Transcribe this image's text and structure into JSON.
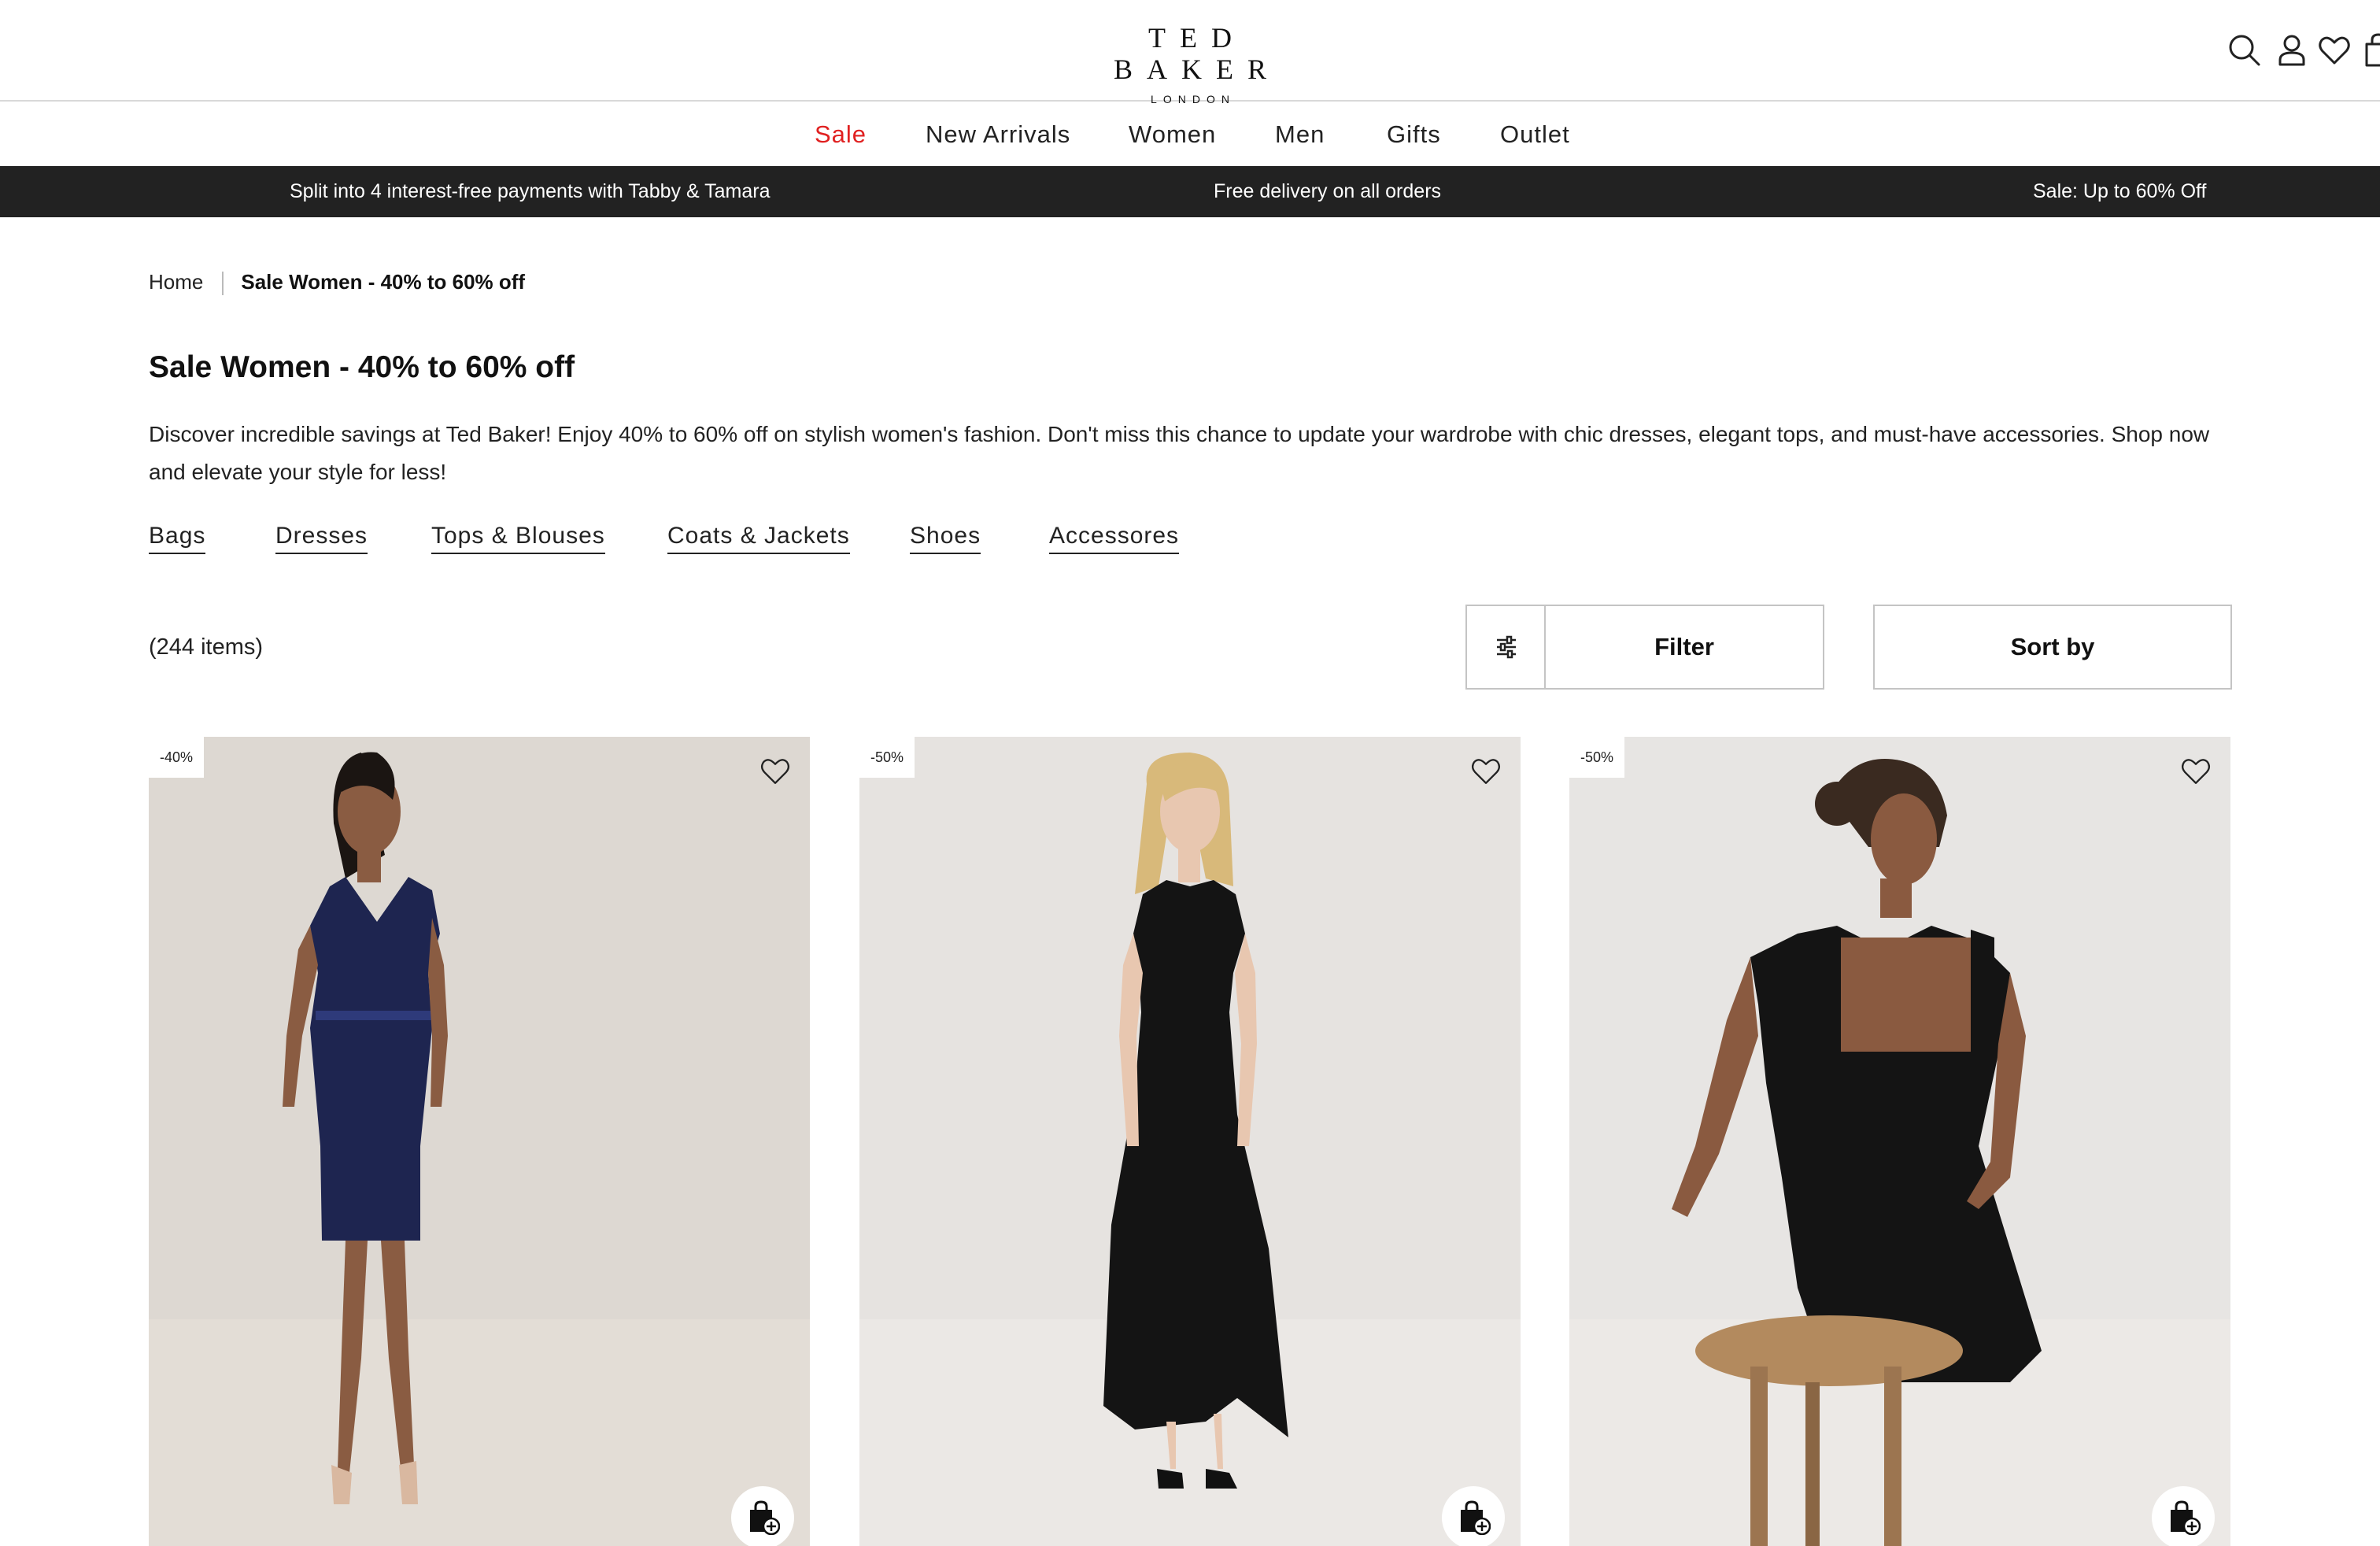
{
  "brand": {
    "name": "TED BAKER",
    "sub": "LONDON"
  },
  "header_icons": [
    "search-icon",
    "account-icon",
    "wishlist-icon",
    "bag-icon"
  ],
  "nav": [
    {
      "label": "Sale",
      "highlight": true
    },
    {
      "label": "New Arrivals"
    },
    {
      "label": "Women"
    },
    {
      "label": "Men"
    },
    {
      "label": "Gifts"
    },
    {
      "label": "Outlet"
    }
  ],
  "promo": [
    "Split into 4 interest-free payments with Tabby & Tamara",
    "Free delivery on all orders",
    "Sale: Up to 60% Off"
  ],
  "breadcrumb": {
    "home": "Home",
    "current": "Sale Women - 40% to 60% off"
  },
  "page_title": "Sale Women - 40% to 60% off",
  "description": "Discover incredible savings at Ted Baker! Enjoy 40% to 60% off on stylish women's fashion. Don't miss this chance to update your wardrobe with chic dresses, elegant tops, and must-have accessories. Shop now and elevate your style for less!",
  "subcategories": [
    "Bags",
    "Dresses",
    "Tops & Blouses",
    "Coats & Jackets",
    "Shoes",
    "Accessores"
  ],
  "item_count": "(244 items)",
  "toolbar": {
    "filter_label": "Filter",
    "sort_label": "Sort by"
  },
  "products": [
    {
      "badge": "-40%",
      "dress_color": "#1e2550",
      "background": "#ddd8d2"
    },
    {
      "badge": "-50%",
      "dress_color": "#141414",
      "background": "#e6e3e0"
    },
    {
      "badge": "-50%",
      "dress_color": "#141414",
      "background": "#e7e5e3"
    }
  ],
  "colors": {
    "sale_red": "#e02020",
    "promo_bar": "#222222",
    "text": "#111111"
  }
}
